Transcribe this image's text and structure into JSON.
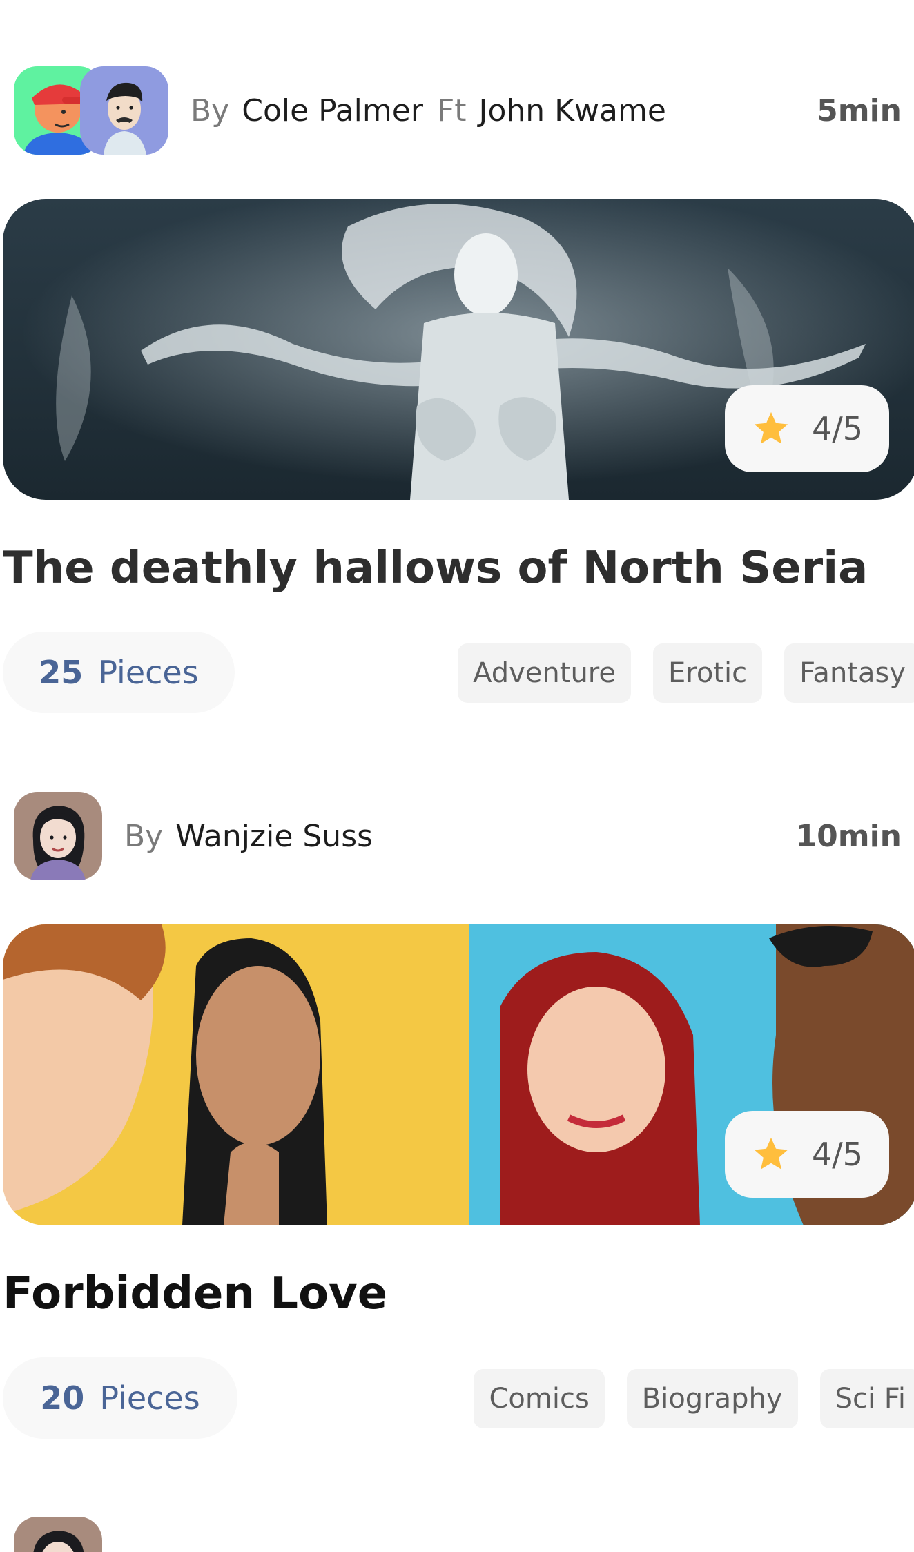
{
  "stories": [
    {
      "byline_prefix": "By",
      "author": "Cole Palmer",
      "featuring_prefix": "Ft",
      "featuring": "John Kwame",
      "read_time": "5min",
      "rating": "4/5",
      "title": "The deathly hallows of North Seria",
      "pieces_count": "25",
      "pieces_label": "Pieces",
      "tags": [
        "Adventure",
        "Erotic",
        "Fantasy"
      ]
    },
    {
      "byline_prefix": "By",
      "author": "Wanjzie Suss",
      "read_time": "10min",
      "rating": "4/5",
      "title": "Forbidden Love",
      "pieces_count": "20",
      "pieces_label": "Pieces",
      "tags": [
        "Comics",
        "Biography",
        "Sci Fi"
      ]
    }
  ],
  "colors": {
    "accent_blue": "#4a6596",
    "star_yellow": "#ffbe3d",
    "chip_background": "#f3f3f3"
  },
  "icons": {
    "rating": "star-icon"
  }
}
